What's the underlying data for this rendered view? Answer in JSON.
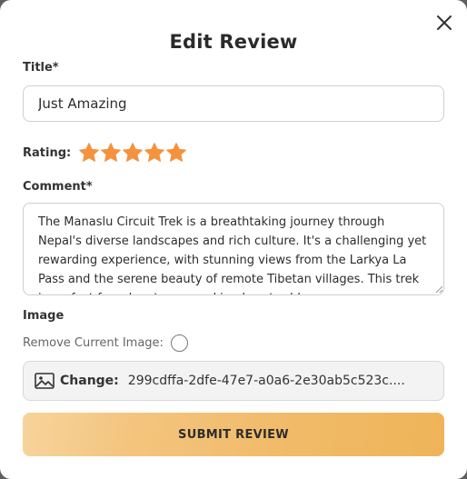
{
  "modal": {
    "title": "Edit Review",
    "close_icon": "close-icon"
  },
  "form": {
    "title_label": "Title*",
    "title_value": "Just Amazing",
    "rating_label": "Rating:",
    "rating": 5,
    "rating_max": 5,
    "star_color": "#f5923e",
    "comment_label": "Comment*",
    "comment_value": "The Manaslu Circuit Trek is a breathtaking journey through Nepal's diverse landscapes and rich culture. It's a challenging yet rewarding experience, with stunning views from the Larkya La Pass and the serene beauty of remote Tibetan villages. This trek is perfect for adventurers seeking less-trodden",
    "image_label": "Image",
    "remove_label": "Remove Current Image:",
    "remove_checked": false,
    "change_label": "Change:",
    "file_name": "299cdffa-2dfe-47e7-a0a6-2e30ab5c523c....",
    "submit_label": "SUBMIT REVIEW"
  },
  "colors": {
    "accent": "#f1bb6a",
    "star": "#f5923e"
  }
}
